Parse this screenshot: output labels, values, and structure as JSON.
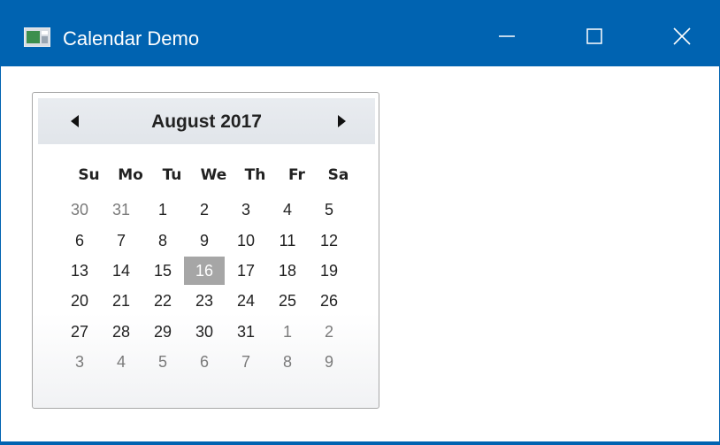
{
  "window": {
    "title": "Calendar Demo",
    "colors": {
      "titlebar": "#0063b1",
      "selected_day": "#a6a6a6"
    }
  },
  "calendar": {
    "month_label": "August 2017",
    "prev_icon": "left-triangle-icon",
    "next_icon": "right-triangle-icon",
    "weekdays": [
      "Su",
      "Mo",
      "Tu",
      "We",
      "Th",
      "Fr",
      "Sa"
    ],
    "weeks": [
      [
        "30",
        "31",
        "1",
        "2",
        "3",
        "4",
        "5"
      ],
      [
        "6",
        "7",
        "8",
        "9",
        "10",
        "11",
        "12"
      ],
      [
        "13",
        "14",
        "15",
        "16",
        "17",
        "18",
        "19"
      ],
      [
        "20",
        "21",
        "22",
        "23",
        "24",
        "25",
        "26"
      ],
      [
        "27",
        "28",
        "29",
        "30",
        "31",
        "1",
        "2"
      ],
      [
        "3",
        "4",
        "5",
        "6",
        "7",
        "8",
        "9"
      ]
    ],
    "selected_day": "16"
  }
}
